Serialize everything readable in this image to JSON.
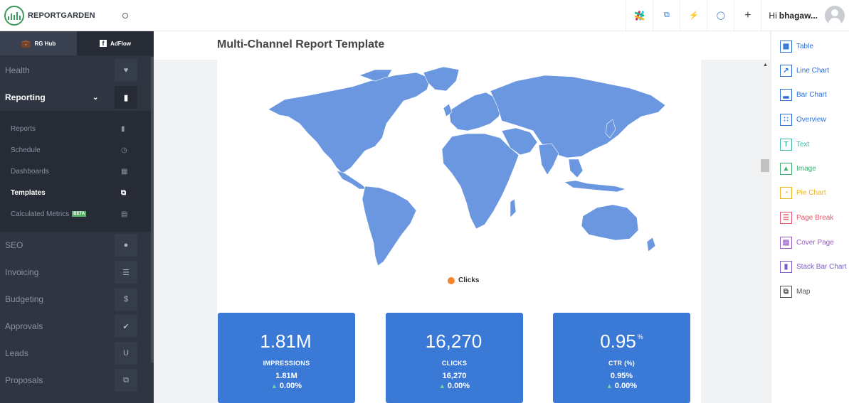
{
  "brand": {
    "name": "REPORTGARDEN",
    "accent": "#3b79d6",
    "logo_color": "#3e9a5c"
  },
  "hub_tabs": [
    {
      "label": "RG Hub",
      "icon": "briefcase-icon"
    },
    {
      "label": "AdFlow",
      "icon": "facebook-icon"
    }
  ],
  "nav": {
    "health": {
      "label": "Health",
      "icon": "heart-icon"
    },
    "reporting": {
      "label": "Reporting",
      "icon": "document-icon"
    },
    "reporting_sub": {
      "reports": {
        "label": "Reports",
        "icon": "file-icon"
      },
      "schedule": {
        "label": "Schedule",
        "icon": "clock-icon"
      },
      "dashboards": {
        "label": "Dashboards",
        "icon": "dashboard-icon"
      },
      "templates": {
        "label": "Templates",
        "icon": "copy-icon"
      },
      "calculated_metrics": {
        "label": "Calculated Metrics",
        "badge": "BETA",
        "icon": "calculator-icon"
      }
    },
    "seo": {
      "label": "SEO",
      "icon": "globe-icon"
    },
    "invoicing": {
      "label": "Invoicing",
      "icon": "list-icon"
    },
    "budgeting": {
      "label": "Budgeting",
      "icon": "dollar-icon"
    },
    "approvals": {
      "label": "Approvals",
      "icon": "thumbs-up-icon"
    },
    "leads": {
      "label": "Leads",
      "icon": "magnet-icon"
    },
    "proposals": {
      "label": "Proposals",
      "icon": "files-icon"
    }
  },
  "topbar": {
    "greeting": "Hi",
    "user": "bhagaw...",
    "actions": [
      "slack-icon",
      "copy-icon",
      "bolt-icon",
      "bulb-icon",
      "plus-icon"
    ]
  },
  "page": {
    "title": "Multi-Channel Report Template"
  },
  "map": {
    "legend": "Clicks",
    "legend_color": "#f2852e",
    "fill_color": "#6a97e0"
  },
  "kpis": [
    {
      "value": "1.81M",
      "unit": "",
      "label": "IMPRESSIONS",
      "sub": "1.81M",
      "change": "0.00%"
    },
    {
      "value": "16,270",
      "unit": "",
      "label": "CLICKS",
      "sub": "16,270",
      "change": "0.00%"
    },
    {
      "value": "0.95",
      "unit": "%",
      "label": "CTR (%)",
      "sub": "0.95%",
      "change": "0.00%"
    }
  ],
  "widgets": {
    "table": {
      "label": "Table",
      "color": "#2b6ed6",
      "icon": "table-icon"
    },
    "line_chart": {
      "label": "Line Chart",
      "color": "#2b6ed6",
      "icon": "line-chart-icon"
    },
    "bar_chart": {
      "label": "Bar Chart",
      "color": "#2b6ed6",
      "icon": "bar-chart-icon"
    },
    "overview": {
      "label": "Overview",
      "color": "#2b6ed6",
      "icon": "overview-icon"
    },
    "text": {
      "label": "Text",
      "color": "#3cb8a6",
      "icon": "text-icon"
    },
    "image": {
      "label": "Image",
      "color": "#3cae6e",
      "icon": "image-icon"
    },
    "pie_chart": {
      "label": "Pie Chart",
      "color": "#f0b41c",
      "icon": "pie-chart-icon"
    },
    "page_break": {
      "label": "Page Break",
      "color": "#e8566b",
      "icon": "page-break-icon"
    },
    "cover_page": {
      "label": "Cover Page",
      "color": "#9b59c6",
      "icon": "cover-page-icon"
    },
    "stack_bar_chart": {
      "label": "Stack Bar Chart",
      "color": "#7b5cc6",
      "icon": "stack-bar-chart-icon"
    },
    "map": {
      "label": "Map",
      "color": "#555555",
      "icon": "map-icon"
    }
  }
}
